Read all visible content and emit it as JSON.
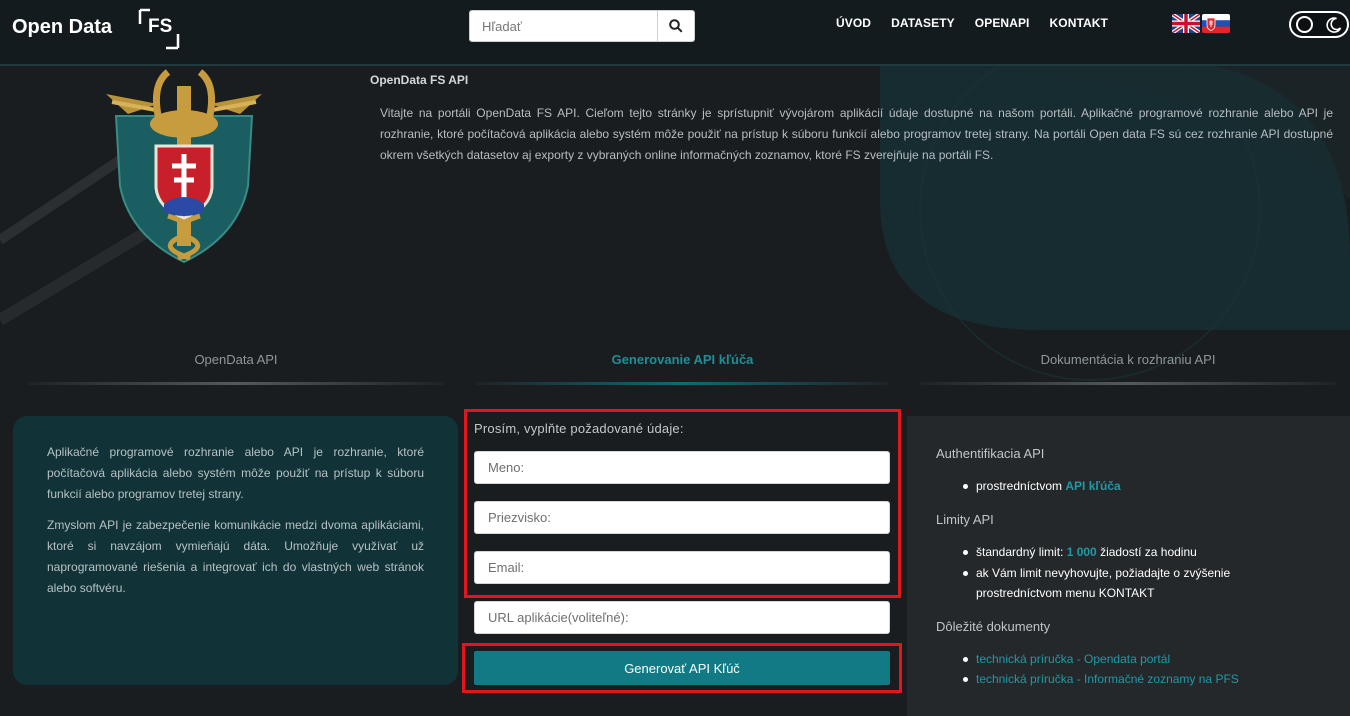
{
  "header": {
    "brand": "Open Data",
    "logo_text": "FS",
    "search_placeholder": "Hľadať",
    "nav": [
      "ÚVOD",
      "DATASETY",
      "OPENAPI",
      "KONTAKT"
    ]
  },
  "hero": {
    "title": "OpenData FS API",
    "text": "Vitajte na portáli OpenData FS API. Cieľom tejto stránky je sprístupniť vývojárom aplikácií údaje dostupné na našom portáli. Aplikačné programové rozhranie alebo API je rozhranie, ktoré počítačová aplikácia alebo systém môže použiť na prístup k súboru funkcií alebo programov tretej strany. Na portáli Open data FS sú cez rozhranie API dostupné okrem všetkých datasetov aj exporty z vybraných online informačných zoznamov, ktoré FS zverejňuje na portáli FS."
  },
  "tabs": [
    "OpenData API",
    "Generovanie API kľúča",
    "Dokumentácia k rozhraniu API"
  ],
  "info": {
    "p1": "Aplikačné programové rozhranie alebo API je rozhranie, ktoré počítačová aplikácia alebo systém môže použiť na prístup k súboru funkcií alebo programov tretej strany.",
    "p2": "Zmyslom API je zabezpečenie komunikácie medzi dvoma aplikáciami, ktoré si navzájom vymieňajú dáta. Umožňuje využívať už naprogramované riešenia a integrovať ich do vlastných web stránok alebo softvéru."
  },
  "form": {
    "label": "Prosím, vyplňte požadované údaje:",
    "first_name_placeholder": "Meno:",
    "last_name_placeholder": "Priezvisko:",
    "email_placeholder": "Email:",
    "url_placeholder": "URL aplikácie(voliteľné):",
    "submit": "Generovať API Kľúč"
  },
  "sidebar": {
    "auth_title": "Authentifikacia API",
    "auth_prefix": "prostredníctvom ",
    "auth_link": "API kľúča",
    "limits_title": "Limity API",
    "limit_prefix": "štandardný limit: ",
    "limit_value": "1 000",
    "limit_suffix": " žiadostí za hodinu",
    "limit_note_1": "ak Vám limit nevyhovujte, požiadajte o zvýšenie",
    "limit_note_2": "prostredníctvom menu KONTAKT",
    "docs_title": "Dôležité dokumenty",
    "doc_links": [
      "technická príručka - Opendata portál",
      "technická príručka - Informačné zoznamy na PFS"
    ]
  },
  "colors": {
    "accent": "#1f8e99",
    "button": "#117a84",
    "highlight": "#e3161e",
    "card": "#113338"
  }
}
